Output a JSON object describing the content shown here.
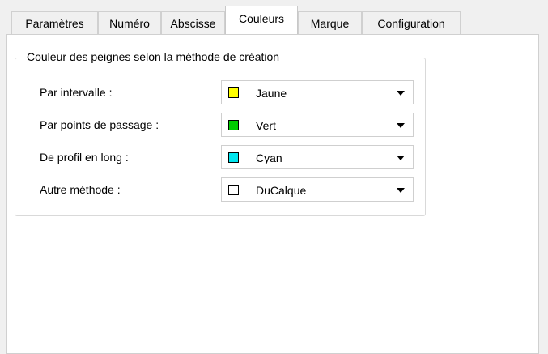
{
  "tabs": [
    {
      "label": "Paramètres"
    },
    {
      "label": "Numéro"
    },
    {
      "label": "Abscisse"
    },
    {
      "label": "Couleurs"
    },
    {
      "label": "Marque"
    },
    {
      "label": "Configuration"
    }
  ],
  "active_tab": "Couleurs",
  "group": {
    "title": "Couleur des peignes selon la méthode de création"
  },
  "rows": [
    {
      "label": "Par intervalle :",
      "value": "Jaune",
      "swatch": "#ffff00"
    },
    {
      "label": "Par points de passage :",
      "value": "Vert",
      "swatch": "#00cc00"
    },
    {
      "label": "De profil en long :",
      "value": "Cyan",
      "swatch": "#00e5ee"
    },
    {
      "label": "Autre méthode :",
      "value": "DuCalque",
      "swatch": "#ffffff"
    }
  ]
}
